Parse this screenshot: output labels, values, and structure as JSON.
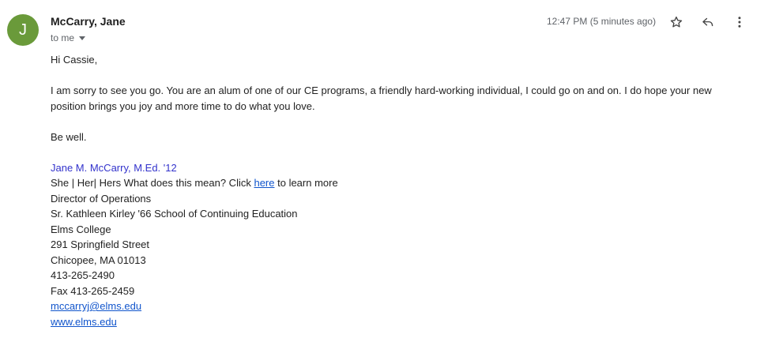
{
  "header": {
    "avatar_letter": "J",
    "sender": "McCarry, Jane",
    "recipient": "to me",
    "timestamp": "12:47 PM (5 minutes ago)",
    "icons": [
      "star-icon",
      "reply-icon",
      "more-vert-icon"
    ]
  },
  "message": {
    "greeting": "Hi Cassie,",
    "paragraph1": "I am sorry to see you go. You are an alum of one of our CE programs, a friendly hard-working individual, I could go on and on. I do hope your new position brings you joy and more time to do what you love.",
    "closing": "Be well.",
    "signature": {
      "name": "Jane M. McCarry, M.Ed. '12",
      "pronouns_prefix": "She | Her| Hers What does this mean? Click ",
      "pronouns_link": "here",
      "pronouns_suffix": " to learn more",
      "title": "Director of Operations",
      "school": "Sr. Kathleen Kirley '66 School of Continuing Education",
      "college": "Elms College",
      "street": "291 Springfield Street",
      "city": "Chicopee, MA 01013",
      "phone": "413-265-2490",
      "fax": "Fax 413-265-2459",
      "email": "mccarryj@elms.edu",
      "website": "www.elms.edu"
    }
  }
}
